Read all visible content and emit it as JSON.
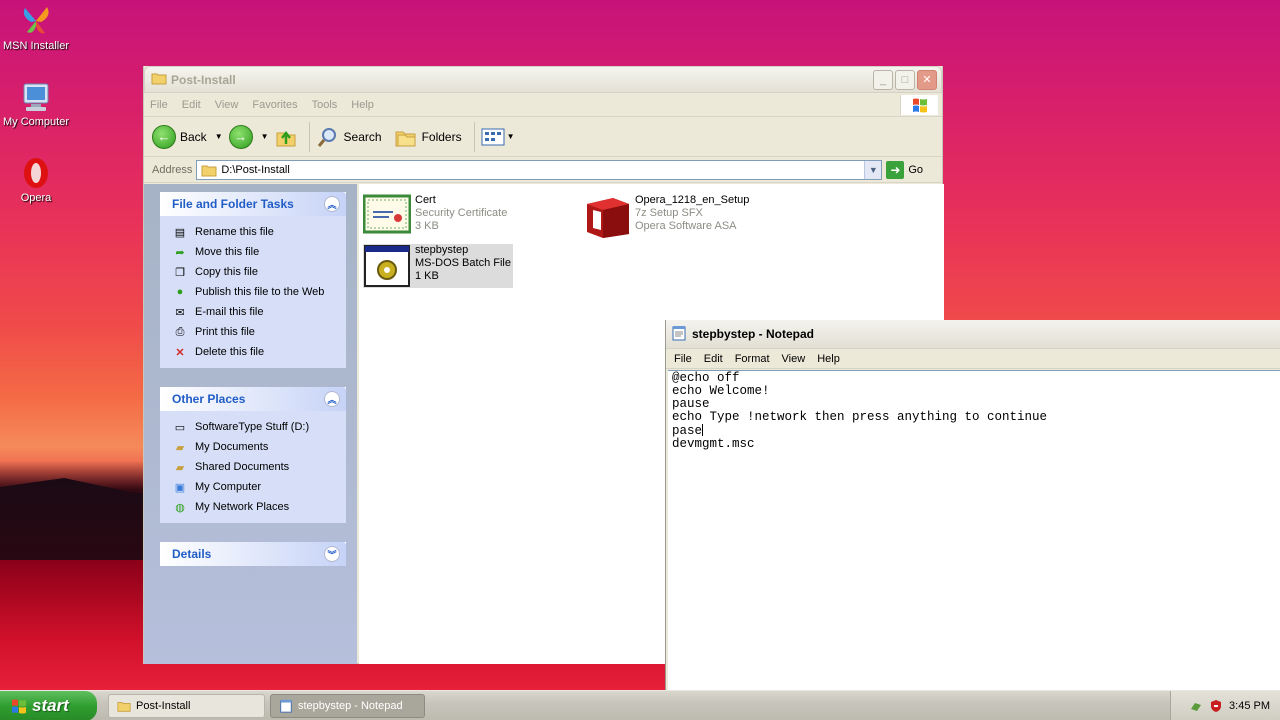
{
  "desktop": {
    "icons": [
      {
        "label": "MSN Installer"
      },
      {
        "label": "My Computer"
      },
      {
        "label": "Opera"
      }
    ]
  },
  "explorer": {
    "title": "Post-Install",
    "menu": [
      "File",
      "Edit",
      "View",
      "Favorites",
      "Tools",
      "Help"
    ],
    "toolbar": {
      "back": "Back",
      "search": "Search",
      "folders": "Folders"
    },
    "address": {
      "label": "Address",
      "value": "D:\\Post-Install",
      "go": "Go"
    },
    "file_tasks": {
      "title": "File and Folder Tasks",
      "items": [
        "Rename this file",
        "Move this file",
        "Copy this file",
        "Publish this file to the Web",
        "E-mail this file",
        "Print this file",
        "Delete this file"
      ]
    },
    "other_places": {
      "title": "Other Places",
      "items": [
        "SoftwareType Stuff (D:)",
        "My Documents",
        "Shared Documents",
        "My Computer",
        "My Network Places"
      ]
    },
    "details": {
      "title": "Details"
    },
    "files": [
      {
        "name": "Cert",
        "type": "Security Certificate",
        "info": "3 KB"
      },
      {
        "name": "Opera_1218_en_Setup",
        "type": "7z Setup SFX",
        "info": "Opera Software ASA"
      },
      {
        "name": "stepbystep",
        "type": "MS-DOS Batch File",
        "info": "1 KB"
      }
    ]
  },
  "notepad": {
    "title": "stepbystep - Notepad",
    "menu": [
      "File",
      "Edit",
      "Format",
      "View",
      "Help"
    ],
    "lines": [
      "@echo off",
      "echo Welcome!",
      "pause",
      "echo Type !network then press anything to continue",
      "pase",
      "devmgmt.msc"
    ]
  },
  "taskbar": {
    "start": "start",
    "tasks": [
      "Post-Install",
      "stepbystep - Notepad"
    ],
    "clock": "3:45 PM"
  }
}
